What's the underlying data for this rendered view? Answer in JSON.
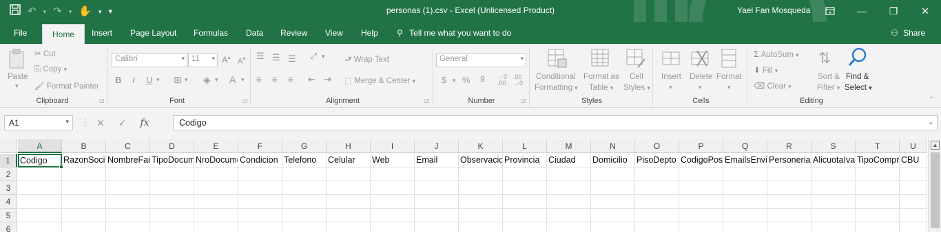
{
  "titlebar": {
    "title": "personas (1).csv  -  Excel (Unlicensed Product)",
    "user": "Yael Fan Mosqueda",
    "qat_more": "≡"
  },
  "tabs": [
    "File",
    "Home",
    "Insert",
    "Page Layout",
    "Formulas",
    "Data",
    "Review",
    "View",
    "Help"
  ],
  "tell_me": "Tell me what you want to do",
  "share": "Share",
  "ribbon": {
    "clipboard": {
      "label": "Clipboard",
      "paste": "Paste",
      "cut": "Cut",
      "copy": "Copy",
      "format_painter": "Format Painter"
    },
    "font": {
      "label": "Font",
      "name": "Calibri",
      "size": "11",
      "bold": "B",
      "italic": "I",
      "underline": "U",
      "grow": "A",
      "shrink": "A"
    },
    "alignment": {
      "label": "Alignment",
      "wrap": "Wrap Text",
      "merge": "Merge & Center"
    },
    "number": {
      "label": "Number",
      "format": "General",
      "currency": "$",
      "percent": "%",
      "comma": "9",
      "inc_dec": ".0\n.00",
      "dec_dec": ".00\n→.0"
    },
    "styles": {
      "label": "Styles",
      "conditional": [
        "Conditional",
        "Formatting"
      ],
      "format_table": [
        "Format as",
        "Table"
      ],
      "cell_styles": [
        "Cell",
        "Styles"
      ]
    },
    "cells": {
      "label": "Cells",
      "insert": "Insert",
      "delete": "Delete",
      "format": "Format"
    },
    "editing": {
      "label": "Editing",
      "autosum": "AutoSum",
      "fill": "Fill",
      "clear": "Clear",
      "sort": [
        "Sort &",
        "Filter"
      ],
      "find": [
        "Find &",
        "Select"
      ]
    }
  },
  "formula_bar": {
    "name_box": "A1",
    "fx": "fx",
    "content": "Codigo"
  },
  "grid": {
    "columns": [
      "A",
      "B",
      "C",
      "D",
      "E",
      "F",
      "G",
      "H",
      "I",
      "J",
      "K",
      "L",
      "M",
      "N",
      "O",
      "P",
      "Q",
      "R",
      "S",
      "T",
      "U"
    ],
    "rows": [
      "1",
      "2",
      "3",
      "4",
      "5",
      "6"
    ],
    "row1": [
      "Codigo",
      "RazonSocial",
      "NombreFantasia",
      "TipoDocumento",
      "NroDocumento",
      "Condicion",
      "Telefono",
      "Celular",
      "Web",
      "Email",
      "Observaciones",
      "Provincia",
      "Ciudad",
      "Domicilio",
      "PisoDepto",
      "CodigoPostal",
      "EmailsEnvio",
      "Personeria",
      "AlicuotaIva",
      "TipoComprobante",
      "CBU"
    ]
  },
  "colors": {
    "brand": "#217346"
  }
}
